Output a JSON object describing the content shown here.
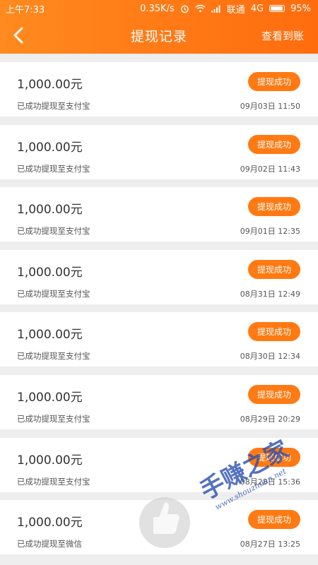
{
  "status_bar": {
    "time": "上午7:33",
    "speed": "0.35K/s",
    "carrier": "联通",
    "network": "4G",
    "battery": "95%",
    "battery_level": 0.95
  },
  "nav": {
    "title": "提现记录",
    "action": "查看到账"
  },
  "records": [
    {
      "amount": "1,000.00元",
      "desc": "已成功提现至支付宝",
      "status": "提现成功",
      "time": "09月03日 11:50"
    },
    {
      "amount": "1,000.00元",
      "desc": "已成功提现至支付宝",
      "status": "提现成功",
      "time": "09月02日 11:43"
    },
    {
      "amount": "1,000.00元",
      "desc": "已成功提现至支付宝",
      "status": "提现成功",
      "time": "09月01日 12:35"
    },
    {
      "amount": "1,000.00元",
      "desc": "已成功提现至支付宝",
      "status": "提现成功",
      "time": "08月31日 12:49"
    },
    {
      "amount": "1,000.00元",
      "desc": "已成功提现至支付宝",
      "status": "提现成功",
      "time": "08月30日 12:34"
    },
    {
      "amount": "1,000.00元",
      "desc": "已成功提现至支付宝",
      "status": "提现成功",
      "time": "08月29日 20:29"
    },
    {
      "amount": "1,000.00元",
      "desc": "已成功提现至支付宝",
      "status": "提现成功",
      "time": "08月28日 15:36"
    },
    {
      "amount": "1,000.00元",
      "desc": "已成功提现至微信",
      "status": "提现成功",
      "time": "08月27日 13:25"
    }
  ],
  "watermark": {
    "text": "手赚之家",
    "url": "www.shouzhuan.net"
  },
  "colors": {
    "accent": "#ff7a12",
    "header_start": "#ff8a1f",
    "header_end": "#ff6c0e"
  }
}
